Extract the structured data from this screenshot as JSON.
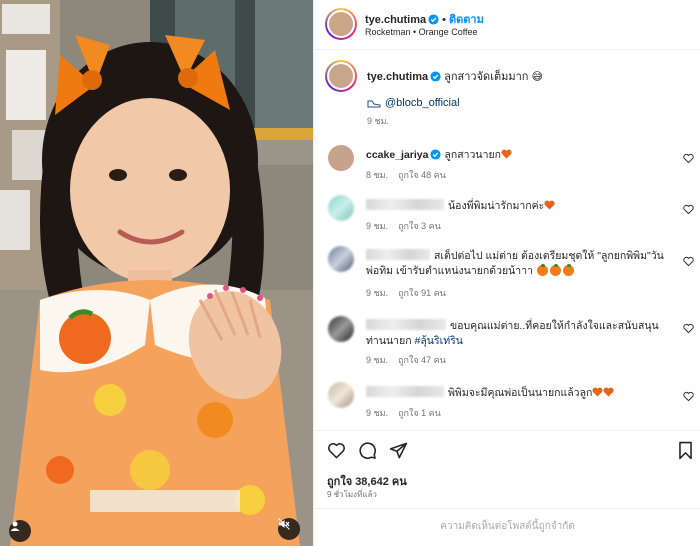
{
  "header": {
    "username": "tye.chutima",
    "follow_label": "ติดตาม",
    "subtitle": "Rocketman • Orange Coffee"
  },
  "caption": {
    "username": "tye.chutima",
    "text": "ลูกสาวจัดเต็มมาก 😅",
    "mention": "@blocb_official",
    "time": "9 ชม."
  },
  "comments": [
    {
      "username": "ccake_jariya",
      "text": "ลูกสาวนายก",
      "time": "8 ชม.",
      "likes": "ถูกใจ 48 คน"
    },
    {
      "username": "",
      "text": "น้องพี่พิมน่ารักมากค่ะ",
      "time": "9 ชม.",
      "likes": "ถูกใจ 3 คน"
    },
    {
      "username": "",
      "text": "สเต็ปต่อไป แม่ต่าย ต้องเตรียมชุดให้ \"ลูกยกพิพิม\"วันพ่อทิม เข้ารับตำแหน่งนายกด้วยน้าาา",
      "time": "9 ชม.",
      "likes": "ถูกใจ 91 คน"
    },
    {
      "username": "",
      "text": "ขอบคุณแม่ต่าย..ที่คอยให้กำลังใจและสนับสนุนท่านนายก",
      "hashtag": "#ลุ้นริเท่ริน",
      "time": "9 ชม.",
      "likes": "ถูกใจ 47 คน"
    },
    {
      "username": "",
      "text": "พิพิมจะมีคุณพ่อเป็นนายกแล้วลูก",
      "time": "9 ชม.",
      "likes": "ถูกใจ 1 คน"
    }
  ],
  "likes_total": "ถูกใจ 38,642 คน",
  "post_time": "9 ชั่วโมงที่แล้ว",
  "comments_closed": "ความคิดเห็นต่อโพสต์นี้ถูกจำกัด",
  "colors": {
    "link": "#0095f6",
    "mention": "#00376b",
    "muted": "#737373",
    "heart": "#e8641b"
  },
  "icons": [
    "heart-icon",
    "comment-icon",
    "share-icon",
    "bookmark-icon",
    "verified-icon",
    "user-icon",
    "mute-icon",
    "threads-icon"
  ]
}
